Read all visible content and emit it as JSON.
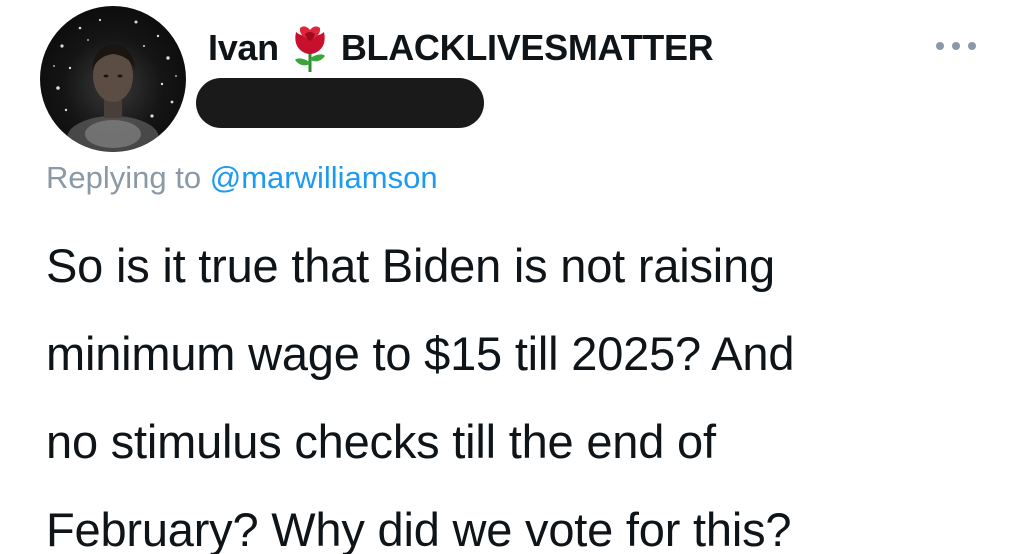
{
  "tweet": {
    "author": {
      "display_name": "Ivan",
      "emoji_icon": "rose-icon",
      "name_suffix": "BLACKLIVESMATTER",
      "handle_redacted": true
    },
    "more_icon": "more-horizontal-icon",
    "reply_prefix": "Replying to",
    "reply_to": "@marwilliamson",
    "body_lines": [
      "So is it true that Biden is not raising",
      "minimum wage to $15 till 2025? And",
      "no stimulus checks till the end of",
      "February? Why did we vote for this?"
    ],
    "colors": {
      "text": "#0f1419",
      "secondary": "#8b98a5",
      "link": "#1d9bf0",
      "redaction": "#1a1a1a"
    }
  }
}
